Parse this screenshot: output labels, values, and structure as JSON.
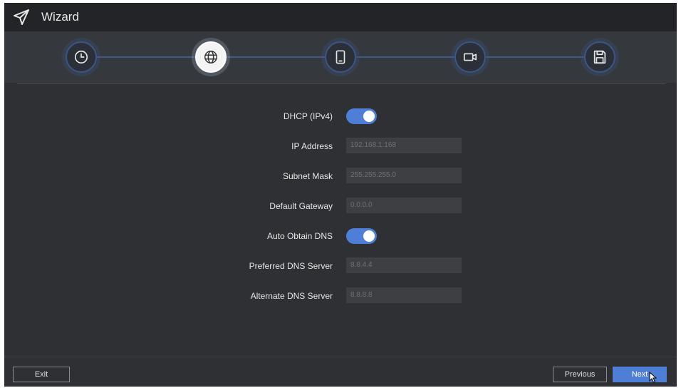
{
  "window": {
    "title": "Wizard"
  },
  "steps": [
    {
      "icon": "clock-icon",
      "active": false
    },
    {
      "icon": "globe-icon",
      "active": true
    },
    {
      "icon": "mobile-icon",
      "active": false
    },
    {
      "icon": "camera-icon",
      "active": false
    },
    {
      "icon": "save-icon",
      "active": false
    }
  ],
  "form": {
    "dhcp": {
      "label": "DHCP (IPv4)",
      "enabled": true
    },
    "ip_address": {
      "label": "IP Address",
      "value": "192.168.1.168"
    },
    "subnet_mask": {
      "label": "Subnet Mask",
      "value": "255.255.255.0"
    },
    "default_gateway": {
      "label": "Default Gateway",
      "value": "0.0.0.0"
    },
    "auto_dns": {
      "label": "Auto Obtain DNS",
      "enabled": true
    },
    "preferred_dns": {
      "label": "Preferred DNS Server",
      "value": "8.8.4.4"
    },
    "alternate_dns": {
      "label": "Alternate DNS Server",
      "value": "8.8.8.8"
    }
  },
  "footer": {
    "exit_label": "Exit",
    "previous_label": "Previous",
    "next_label": "Next"
  },
  "colors": {
    "accent": "#4f7ed6",
    "background": "#2e3034",
    "titlebar": "#222428"
  }
}
